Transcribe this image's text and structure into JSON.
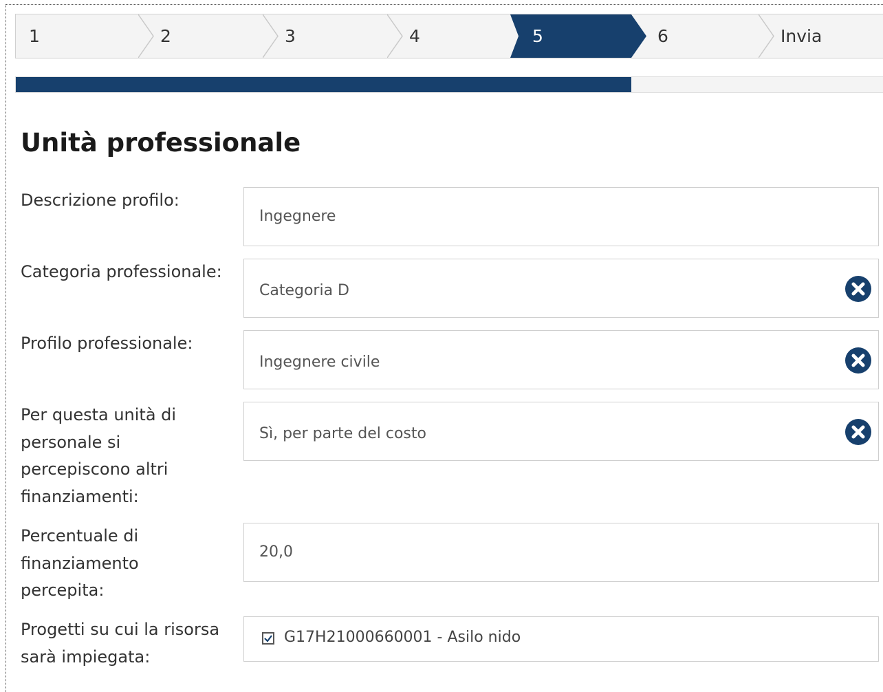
{
  "wizard": {
    "steps": [
      {
        "label": "1",
        "active": false
      },
      {
        "label": "2",
        "active": false
      },
      {
        "label": "3",
        "active": false
      },
      {
        "label": "4",
        "active": false
      },
      {
        "label": "5",
        "active": true
      },
      {
        "label": "6",
        "active": false
      },
      {
        "label": "Invia",
        "active": false
      }
    ],
    "progress_fraction": 0.706
  },
  "colors": {
    "accent": "#17406d",
    "step_bg": "#f4f4f4",
    "border": "#cfcfcf"
  },
  "page_title": "Unità professionale",
  "form": {
    "descrizione": {
      "label": "Descrizione profilo:",
      "value": "Ingegnere"
    },
    "categoria": {
      "label": "Categoria professionale:",
      "value": "Categoria D",
      "icon": "clear-icon"
    },
    "profilo": {
      "label": "Profilo professionale:",
      "value": "Ingegnere civile",
      "icon": "clear-icon"
    },
    "finanziamenti": {
      "label": "Per questa unità di personale si percepiscono altri finanziamenti:",
      "value": "Sì, per parte del costo",
      "icon": "clear-icon"
    },
    "percentuale": {
      "label": "Percentuale di finanziamento percepita:",
      "value": "20,0"
    },
    "progetti": {
      "label": "Progetti su cui la risorsa sarà impiegata:",
      "value": "G17H21000660001 - Asilo nido",
      "checked": true
    }
  }
}
